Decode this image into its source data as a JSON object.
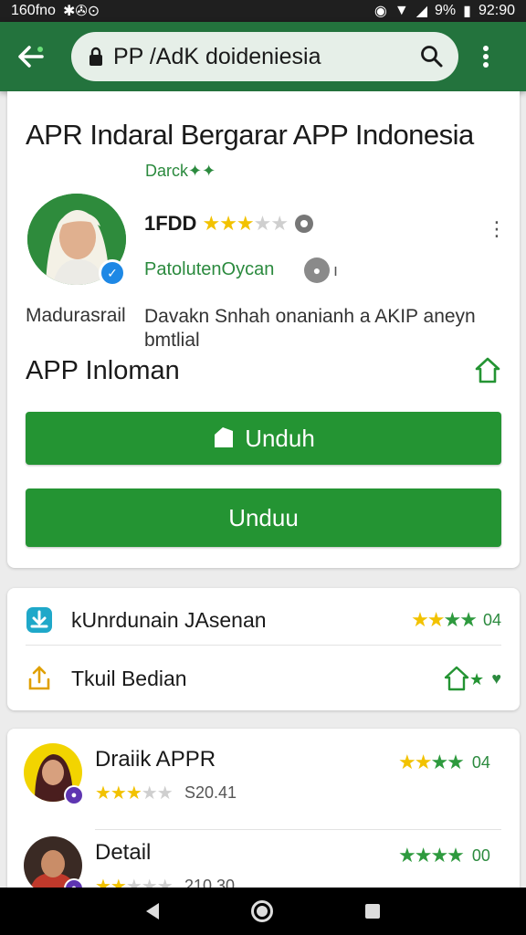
{
  "status_bar": {
    "left_text": "160fno",
    "left_icons": "✱✇⊙",
    "battery": "9%",
    "time": "92:90"
  },
  "app_bar": {
    "url": "PP /AdK doideniesia"
  },
  "app": {
    "title": "APR Indaral Bergarar APP Indonesia",
    "dev_tag": "Darck✦✦",
    "rating_value": "1FDD",
    "publisher": "PatolutenOycan",
    "publisher_mark": "ı",
    "category": "Madurasrail",
    "description": "Davakn Snhah onanianh a AKIP aneyn bmtlial",
    "section_title": "APP Inloman",
    "install_label": "Unduh",
    "download_label": "Unduu"
  },
  "info_rows": [
    {
      "label": "kUnrdunain JAsenan",
      "value": "04"
    },
    {
      "label": "Tkuil Bedian"
    }
  ],
  "reviews": [
    {
      "name": "Draiik APPR",
      "count": "S20.41",
      "score": "04"
    },
    {
      "name": "Detail",
      "count": "210.30",
      "score": "00"
    }
  ],
  "colors": {
    "primary": "#23733d",
    "button": "#249433",
    "star": "#f2c200",
    "accent_green": "#2b8a3e"
  }
}
